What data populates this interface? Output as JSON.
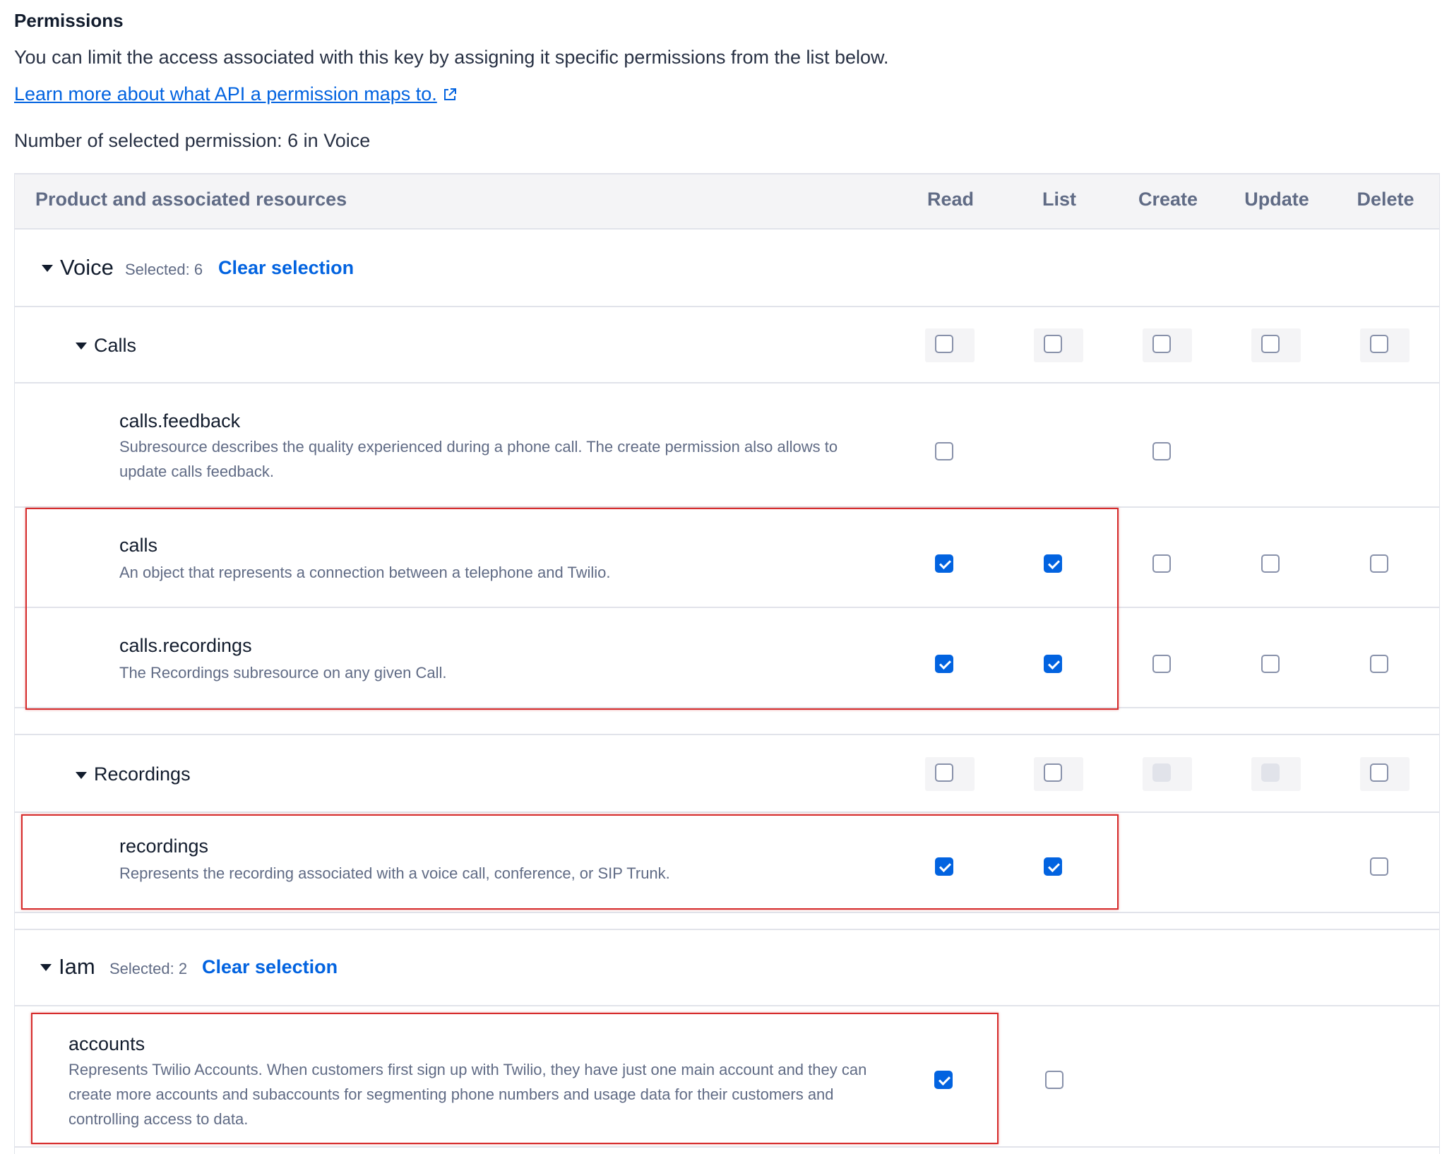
{
  "header": {
    "title": "Permissions",
    "intro": "You can limit the access associated with this key by assigning it specific permissions from the list below.",
    "learn_more": "Learn more about what API a permission maps to.",
    "selected_count": "Number of selected permission: 6 in Voice"
  },
  "table": {
    "columns": [
      "Product and associated resources",
      "Read",
      "List",
      "Create",
      "Update",
      "Delete"
    ]
  },
  "voice": {
    "name": "Voice",
    "selected": "Selected: 6",
    "clear": "Clear selection",
    "calls_group": {
      "name": "Calls",
      "resources": [
        {
          "name": "calls.feedback",
          "desc": "Subresource describes the quality experienced during a phone call. The create permission also allows to update calls feedback.",
          "read": false,
          "create": false
        },
        {
          "name": "calls",
          "desc": "An object that represents a connection between a telephone and Twilio.",
          "read": true,
          "list": true,
          "create": false,
          "update": false,
          "delete": false
        },
        {
          "name": "calls.recordings",
          "desc": "The Recordings subresource on any given Call.",
          "read": true,
          "list": true,
          "create": false,
          "update": false,
          "delete": false
        }
      ]
    },
    "recordings_group": {
      "name": "Recordings",
      "resources": [
        {
          "name": "recordings",
          "desc": "Represents the recording associated with a voice call, conference, or SIP Trunk.",
          "read": true,
          "list": true,
          "delete": false
        }
      ]
    }
  },
  "iam": {
    "name": "Iam",
    "selected": "Selected: 2",
    "clear": "Clear selection",
    "resources": [
      {
        "name": "accounts",
        "desc": "Represents Twilio Accounts. When customers first sign up with Twilio, they have just one main account and they can create more accounts and subaccounts for segmenting phone numbers and usage data for their customers and controlling access to data.",
        "read": true,
        "list": false
      }
    ]
  },
  "colors": {
    "accent": "#0263e0",
    "highlight": "#d62c2c"
  }
}
